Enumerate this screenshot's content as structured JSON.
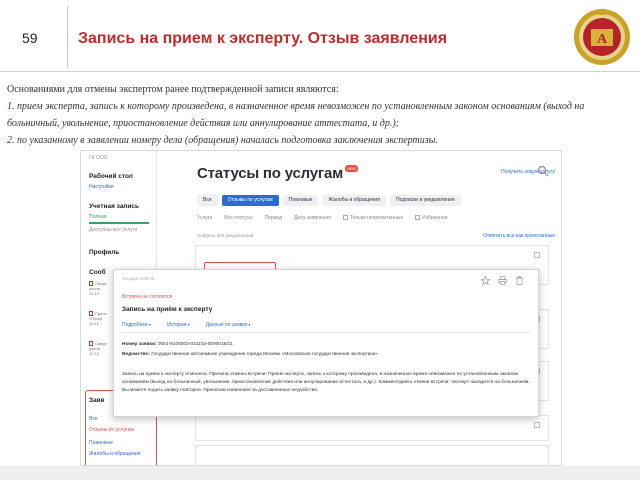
{
  "slide": {
    "number": "59",
    "title": "Запись на прием к эксперту. Отзыв заявления",
    "emblem_letter": "А"
  },
  "body": {
    "lead": "Основаниями для отмены экспертом ранее подтвержденной записи являются:",
    "line1a": "1. прием эксперта, запись к которому произведена, в назначенное время невозможен по установленным законом основаниям (выход на",
    "line1b": "больничный, увольнение, приостановление действия или аннулирование аттестата, и др.);",
    "line2": "2. по указанному в заявлении номеру дела (обращения) началась подготовка заключения экспертизы."
  },
  "screen": {
    "sidebar": {
      "org": "ГК ООО",
      "desk_title": "Рабочий стол",
      "desk_sub": "Настройки",
      "account_title": "Учетная запись",
      "account_sub": "Полная",
      "account_note": "Доступны все услуги",
      "profile": "Профиль",
      "messages": "Сооб",
      "docs": [
        {
          "t1": "Сведе",
          "t2": "рекла",
          "t3": "10.12"
        },
        {
          "t1": "Прило",
          "t2": "«Проф",
          "t3": "10.12"
        },
        {
          "t1": "Сведе",
          "t2": "рекла",
          "t3": "12.12"
        }
      ],
      "apps_title": "Заяв",
      "apps_items": [
        "Все",
        "Отзывы по услугам",
        "Плановые",
        "Жалобы и обращения"
      ]
    },
    "main": {
      "title": "Статусы по услугам",
      "badge": "NEW",
      "top_link": "Получить новую услугу",
      "tabs": [
        "Все",
        "Отзывы по услугам",
        "Плановые",
        "Жалобы и обращения",
        "Подписки и уведомления"
      ],
      "active_tab": 1,
      "filters": [
        "Услуга",
        "Все статусы",
        "Период",
        "Дата заявления",
        "Только непрочитанные",
        "Избранное"
      ],
      "found": "Найдено 359 уведомлений",
      "mark_read": "Отметить все как прочитанные"
    },
    "popup": {
      "date": "сегодня в 09:18",
      "status": "Встреча не состоится",
      "title": "Запись на приём к эксперту",
      "tabs": [
        "Подробнее",
        "История",
        "Данные по заявке"
      ],
      "number_label": "Номер заявки:",
      "number_value": "0001-9100003-031103-0000016/21",
      "agency_label": "Ведомство:",
      "agency_value": "Государственное автономное учреждение города Москвы «Московская государственная экспертиза»",
      "text": "Запись на прием к эксперту отменена. Причина отмены встречи: Прием эксперта, запись к которому произведена, в назначенное время невозможен по установленным законом основаниям (выход на больничный, увольнение, приостановление действия или аннулирование аттестата, и др.). Комментарий к отмене встречи: Эксперт находится на больничном.. Вы можете подать заявку повторно. Приносим извинения за доставленные неудобства."
    }
  },
  "colors": {
    "title_red": "#c42a2a",
    "accent_blue": "#2b6cd4",
    "status_red": "#d9534f"
  }
}
